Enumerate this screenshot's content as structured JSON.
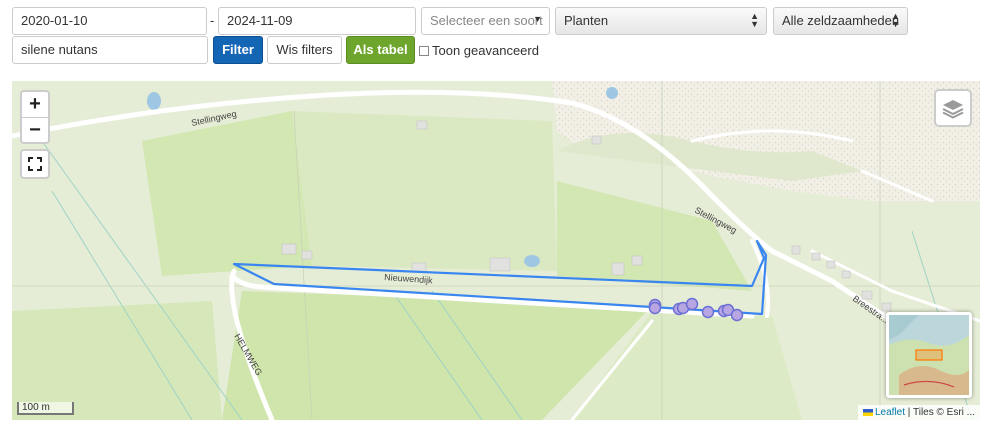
{
  "filters": {
    "date_from": "2020-01-10",
    "date_separator": "-",
    "date_to": "2024-11-09",
    "species_placeholder": "Selecteer een soort",
    "group_select": "Planten",
    "rarity_select": "Alle zeldzaamheden",
    "search_value": "silene nutans",
    "filter_button": "Filter",
    "clear_button": "Wis filters",
    "table_button": "Als tabel",
    "advanced_label": "Toon geavanceerd"
  },
  "map": {
    "zoom_in": "+",
    "zoom_out": "−",
    "streets": {
      "stellingweg_west": "Stellingweg",
      "stellingweg_east": "Stellingweg",
      "nieuwendijk": "Nieuwendijk",
      "helmweg": "HELMWEG",
      "breestraat": "Breestra..."
    },
    "scale_label": "100 m",
    "attribution_link": "Leaflet",
    "attribution_text": "| Tiles © Esri ...",
    "observations_count": 9,
    "colors": {
      "polygon": "#3a86f0",
      "marker_fill": "#b7a6e2",
      "marker_stroke": "#6b6fd4",
      "meadow": "#d3e7b3",
      "background": "#e9efd8"
    }
  }
}
